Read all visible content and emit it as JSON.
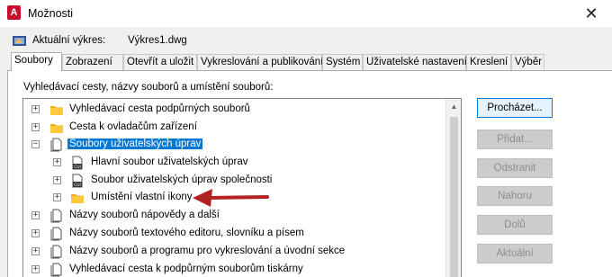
{
  "window": {
    "title": "Možnosti",
    "close": "✕",
    "app_icon_letter": "A"
  },
  "drawing": {
    "label": "Aktuální výkres:",
    "value": "Výkres1.dwg"
  },
  "tabs": [
    {
      "label": "Soubory",
      "active": true
    },
    {
      "label": "Zobrazení"
    },
    {
      "label": "Otevřít a uložit"
    },
    {
      "label": "Vykreslování a publikování"
    },
    {
      "label": "Systém"
    },
    {
      "label": "Uživatelské nastavení"
    },
    {
      "label": "Kreslení"
    },
    {
      "label": "Výběr"
    }
  ],
  "files": {
    "section_label": "Vyhledávací cesty, názvy souborů a umístění souborů:",
    "tree": [
      {
        "label": "Vyhledávací cesta podpůrných souborů",
        "icon": "folder-icon",
        "expander": "+"
      },
      {
        "label": "Cesta k ovladačům zařízení",
        "icon": "folder-icon",
        "expander": "+"
      },
      {
        "label": "Soubory uživatelských úprav",
        "icon": "documents-icon",
        "expander": "−",
        "selected": true
      },
      {
        "label": "Hlavní soubor uživatelských úprav",
        "icon": "cui-file-icon",
        "expander": "+"
      },
      {
        "label": "Soubor uživatelských úprav společnosti",
        "icon": "cui-file-icon",
        "expander": "+"
      },
      {
        "label": "Umístění vlastní ikony",
        "icon": "folder-icon",
        "expander": "+"
      },
      {
        "label": "Názvy souborů nápovědy a další",
        "icon": "documents-icon",
        "expander": "+"
      },
      {
        "label": "Názvy souborů textového editoru, slovníku a písem",
        "icon": "documents-icon",
        "expander": "+"
      },
      {
        "label": "Názvy souborů a programu pro vykreslování a úvodní sekce",
        "icon": "documents-icon",
        "expander": "+"
      },
      {
        "label": "Vyhledávací cesta k podpůrným souborům tiskárny",
        "icon": "documents-icon",
        "expander": "+"
      }
    ]
  },
  "buttons": {
    "browse": "Procházet...",
    "add": "Přidat...",
    "remove": "Odstranit",
    "move_up": "Nahoru",
    "move_down": "Dolů",
    "set_current": "Aktuální"
  },
  "scrollbar": {
    "up_arrow": "▲"
  },
  "colors": {
    "accent": "#0078d7",
    "annotation_arrow": "#b22222",
    "folder": "#f5a623",
    "app_icon": "#c8102e"
  }
}
